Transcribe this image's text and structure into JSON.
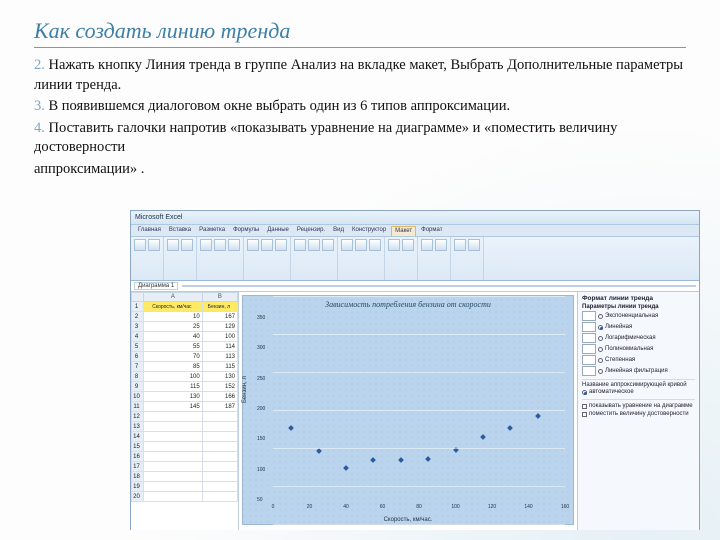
{
  "slide": {
    "title": "Как создать линию тренда",
    "p1a": "2.",
    "p1b": " Нажать кнопку Линия тренда в группе Анализ на вкладке макет, Выбрать Дополнительные параметры линии тренда.",
    "p2a": "3.",
    "p2b": "  В появившемся диалоговом окне выбрать один из 6 типов аппроксимации.",
    "p3a": "4.",
    "p3b": " Поставить галочки напротив «показывать уравнение на диаграмме» и «поместить величину достоверности",
    "p4": "аппроксимации» ."
  },
  "excel": {
    "tabs": [
      "Главная",
      "Вставка",
      "Разметка",
      "Формулы",
      "Данные",
      "Рецензир.",
      "Вид",
      "Конструктор",
      "Макет",
      "Формат"
    ],
    "fb_name": "Диаграмма 1",
    "col1": "Скорость, км/час",
    "col2": "Бензин, л",
    "rows": [
      [
        10,
        167
      ],
      [
        25,
        129
      ],
      [
        40,
        100
      ],
      [
        55,
        114
      ],
      [
        70,
        113
      ],
      [
        85,
        115
      ],
      [
        100,
        130
      ],
      [
        115,
        152
      ],
      [
        130,
        166
      ],
      [
        145,
        187
      ]
    ]
  },
  "chart_data": {
    "type": "scatter",
    "title": "Зависимость потребления бензина от скорости",
    "xlabel": "Скорость, км/час.",
    "ylabel": "Бензин, л",
    "xlim": [
      0,
      160
    ],
    "ylim": [
      50,
      350
    ],
    "yticks": [
      50,
      100,
      150,
      200,
      250,
      300,
      350
    ],
    "xticks": [
      0,
      20,
      40,
      60,
      80,
      100,
      120,
      140,
      160
    ],
    "series": [
      {
        "name": "Бензин",
        "points": [
          [
            10,
            167
          ],
          [
            25,
            129
          ],
          [
            40,
            100
          ],
          [
            55,
            114
          ],
          [
            70,
            113
          ],
          [
            85,
            115
          ],
          [
            100,
            130
          ],
          [
            115,
            152
          ],
          [
            130,
            166
          ],
          [
            145,
            187
          ]
        ]
      }
    ]
  },
  "pane": {
    "title": "Формат линии тренда",
    "sec1": "Параметры линии тренда",
    "opts": [
      "Экспоненциальная",
      "Линейная",
      "Логарифмическая",
      "Полиномиальная",
      "Степенная",
      "Линейная фильтрация"
    ],
    "sec2": "Название аппроксимирующей кривой",
    "auto": "автоматическое",
    "chk1": "показывать уравнение на диаграмме",
    "chk2": "поместить величину достоверности"
  }
}
